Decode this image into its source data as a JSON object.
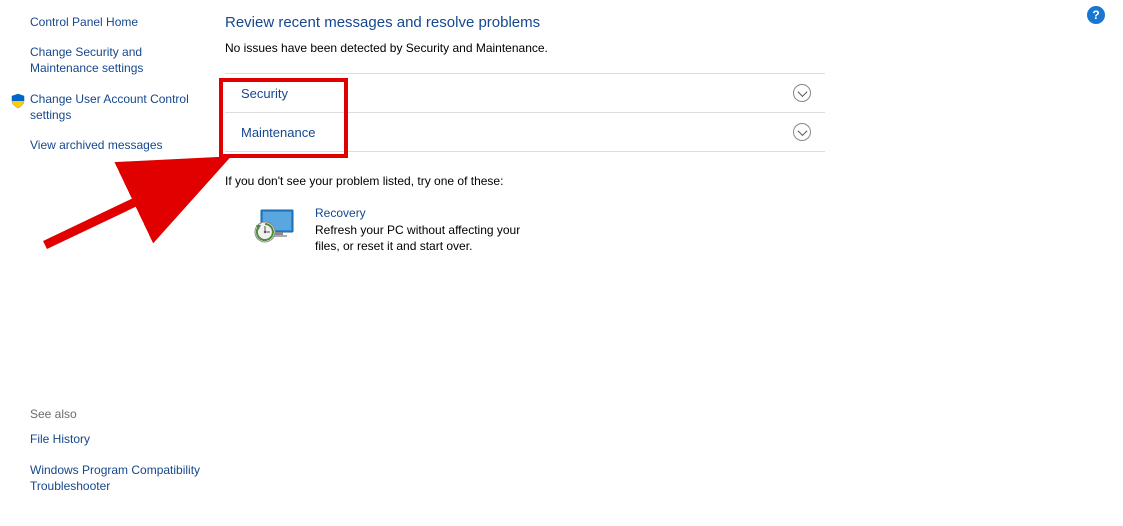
{
  "sidebar": {
    "home": "Control Panel Home",
    "links": [
      "Change Security and Maintenance settings",
      "Change User Account Control settings",
      "View archived messages"
    ]
  },
  "main": {
    "title": "Review recent messages and resolve problems",
    "status": "No issues have been detected by Security and Maintenance.",
    "sections": [
      "Security",
      "Maintenance"
    ],
    "hint": "If you don't see your problem listed, try one of these:",
    "recovery": {
      "title": "Recovery",
      "desc": "Refresh your PC without affecting your files, or reset it and start over."
    }
  },
  "see_also": {
    "heading": "See also",
    "links": [
      "File History",
      "Windows Program Compatibility Troubleshooter"
    ]
  },
  "help_glyph": "?"
}
